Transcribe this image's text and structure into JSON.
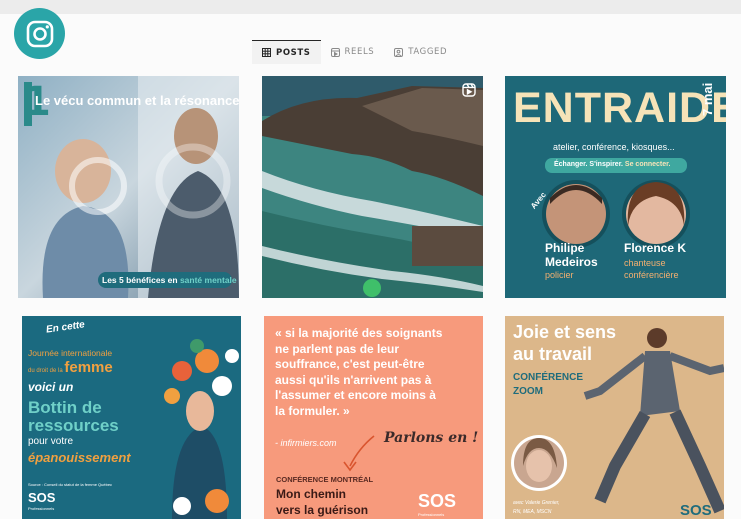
{
  "tabs": [
    {
      "label": "POSTS",
      "icon": "grid-icon",
      "active": true
    },
    {
      "label": "REELS",
      "icon": "reels-icon",
      "active": false
    },
    {
      "label": "TAGGED",
      "icon": "tagged-icon",
      "active": false
    }
  ],
  "posts": [
    {
      "number": "1",
      "title": "Le vécu commun et la résonance",
      "badge_prefix": "Les 5 bénéfices en ",
      "badge_highlight": "santé mentale"
    },
    {
      "type": "reel",
      "icon": "reel-icon"
    },
    {
      "title": "ENTRAIDE",
      "date": "7 mai",
      "subtitle": "atelier, conférence, kiosques...",
      "tagline_main": "Échanger. S'inspirer. ",
      "tagline_accent": "Se connecter.",
      "with": "Avec",
      "speakers": [
        {
          "name_line1": "Philipe",
          "name_line2": "Medeiros",
          "role_line1": "policier",
          "role_line2": ""
        },
        {
          "name_line1": "Florence K",
          "name_line2": "",
          "role_line1": "chanteuse",
          "role_line2": "conférencière"
        }
      ]
    },
    {
      "line1": "En cette",
      "line2": "Journée internationale",
      "line3_prefix": "du droit de la ",
      "line3_accent": "femme",
      "line4": "voici un",
      "line5": "Bottin de",
      "line6": "ressources",
      "line7": "pour votre",
      "line8": "épanouissement",
      "source": "Source : Conseil du statut de la femme Québec",
      "logo": "SOS",
      "logo_sub": "Professionnels"
    },
    {
      "quote": [
        "« si la majorité des soignants",
        "ne parlent pas de leur",
        "souffrance, c'est peut-être",
        "aussi qu'ils n'arrivent pas à",
        "l'assumer et encore moins à",
        "la formuler. »"
      ],
      "attribution": "- infirmiers.com",
      "script": "Parlons en !",
      "conf_label": "CONFÉRENCE MONTRÉAL",
      "conf_title_1": "Mon chemin",
      "conf_title_2": "vers la guérison",
      "logo": "SOS",
      "logo_sub": "Professionnels"
    },
    {
      "title_1": "Joie et sens",
      "title_2": "au travail",
      "label_1": "CONFÉRENCE",
      "label_2": "ZOOM",
      "speaker_1": "avec Valerie Grenier,",
      "speaker_2": "RN, MEA, MSCN",
      "logo": "SOS"
    }
  ]
}
